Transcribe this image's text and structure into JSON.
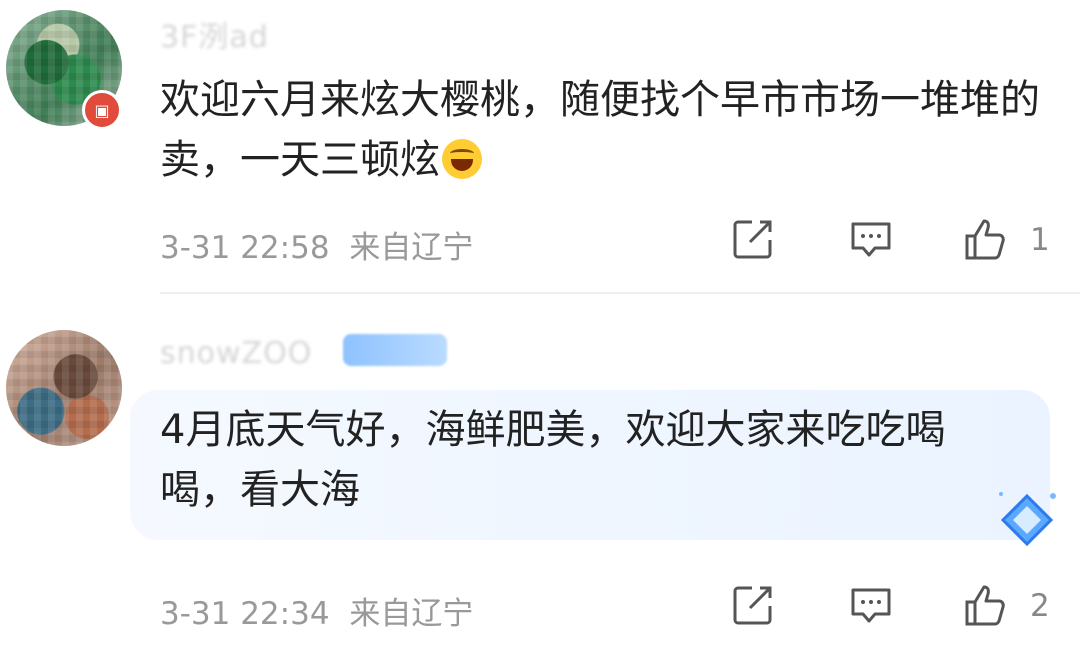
{
  "comments": [
    {
      "username": "3F洌ad",
      "badge_text": "🔳",
      "text": "欢迎六月来炫大樱桃，随便找个早市市场一堆堆的卖，一天三顿炫",
      "emoji": "laugh-cry",
      "timestamp": "3-31 22:58",
      "location": "来自辽宁",
      "likes": "1"
    },
    {
      "username": "snowZOO",
      "text": "4月底天气好，海鲜肥美，欢迎大家来吃吃喝喝，看大海",
      "timestamp": "3-31 22:34",
      "location": "来自辽宁",
      "likes": "2"
    }
  ],
  "colors": {
    "text": "#222222",
    "meta": "#999999",
    "bubble": "#eaf3ff",
    "vip_badge": "#e04b3c"
  }
}
